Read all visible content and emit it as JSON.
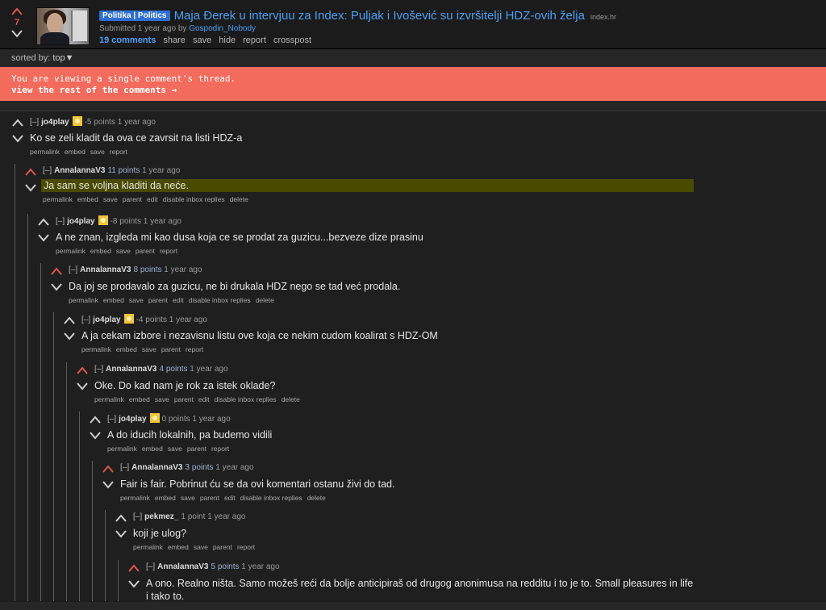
{
  "post": {
    "score": "7",
    "flair": "Politika | Politics",
    "title": "Maja Đerek u intervjuu za Index: Puljak i Ivošević su izvršitelji HDZ-ovih želja",
    "domain": "index.hr",
    "submitted_prefix": "Submitted 1 year ago by ",
    "author": "Gospodin_Nobody",
    "buttons": [
      "19 comments",
      "share",
      "save",
      "hide",
      "report",
      "crosspost"
    ]
  },
  "sort": {
    "label": "sorted by:",
    "value": "top▼"
  },
  "notice": {
    "line1": "You are viewing a single comment's thread.",
    "line2": "view the rest of the comments →"
  },
  "colors": {
    "accent_blue": "#4a9ff5",
    "upvote": "#e0564c",
    "notice_bg": "#f26b5d",
    "highlight": "#4a4a00"
  },
  "comments": [
    {
      "author": "jo4play",
      "flair": true,
      "points": "-5 points",
      "time": "1 year ago",
      "upvoted": false,
      "text": "Ko se zeli kladit da ova ce zavrsit na listi HDZ-a",
      "buttons": [
        "permalink",
        "embed",
        "save",
        "report"
      ]
    },
    {
      "author": "AnnalannaV3",
      "flair": false,
      "points": "11 points",
      "time": "1 year ago",
      "upvoted": true,
      "text": "Ja sam se voljna kladiti da neće.",
      "buttons": [
        "permalink",
        "embed",
        "save",
        "parent",
        "edit",
        "disable inbox replies",
        "delete"
      ]
    },
    {
      "author": "jo4play",
      "flair": true,
      "points": "-8 points",
      "time": "1 year ago",
      "upvoted": false,
      "text": "A ne znan, izgleda mi kao dusa koja ce se prodat za guzicu...bezveze dize prasinu",
      "buttons": [
        "permalink",
        "embed",
        "save",
        "parent",
        "report"
      ]
    },
    {
      "author": "AnnalannaV3",
      "flair": false,
      "points": "8 points",
      "time": "1 year ago",
      "upvoted": true,
      "text": "Da joj se prodavalo za guzicu, ne bi drukala HDZ nego se tad već prodala.",
      "buttons": [
        "permalink",
        "embed",
        "save",
        "parent",
        "edit",
        "disable inbox replies",
        "delete"
      ]
    },
    {
      "author": "jo4play",
      "flair": true,
      "points": "-4 points",
      "time": "1 year ago",
      "upvoted": false,
      "text": "A ja cekam izbore i nezavisnu listu ove koja ce nekim cudom koalirat s HDZ-OM",
      "buttons": [
        "permalink",
        "embed",
        "save",
        "parent",
        "report"
      ]
    },
    {
      "author": "AnnalannaV3",
      "flair": false,
      "points": "4 points",
      "time": "1 year ago",
      "upvoted": true,
      "text": "Oke. Do kad nam je rok za istek oklade?",
      "buttons": [
        "permalink",
        "embed",
        "save",
        "parent",
        "edit",
        "disable inbox replies",
        "delete"
      ]
    },
    {
      "author": "jo4play",
      "flair": true,
      "points": "0 points",
      "time": "1 year ago",
      "upvoted": false,
      "text": "A do iducih lokalnih, pa budemo vidili",
      "buttons": [
        "permalink",
        "embed",
        "save",
        "parent",
        "report"
      ]
    },
    {
      "author": "AnnalannaV3",
      "flair": false,
      "points": "3 points",
      "time": "1 year ago",
      "upvoted": true,
      "text": "Fair is fair. Pobrinut ću se da ovi komentari ostanu živi do tad.",
      "buttons": [
        "permalink",
        "embed",
        "save",
        "parent",
        "edit",
        "disable inbox replies",
        "delete"
      ]
    },
    {
      "author": "pekmez_",
      "flair": false,
      "points": "1 point",
      "time": "1 year ago",
      "upvoted": false,
      "text": "koji je ulog?",
      "buttons": [
        "permalink",
        "embed",
        "save",
        "parent",
        "report"
      ]
    },
    {
      "author": "AnnalannaV3",
      "flair": false,
      "points": "5 points",
      "time": "1 year ago",
      "upvoted": true,
      "text": "A ono. Realno ništa. Samo možeš reći da bolje anticipiraš od drugog anonimusa na redditu i to je to. Small pleasures in life i tako to.",
      "buttons": []
    }
  ]
}
